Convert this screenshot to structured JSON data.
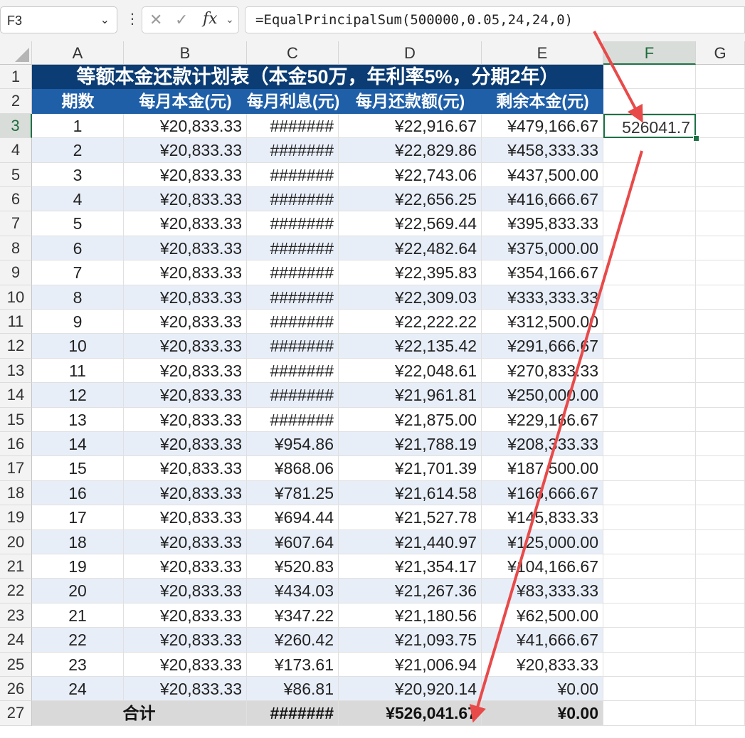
{
  "namebox": {
    "value": "F3"
  },
  "formula_bar": {
    "formula": "=EqualPrincipalSum(500000,0.05,24,24,0)",
    "fx_label": "fx"
  },
  "columns": [
    "A",
    "B",
    "C",
    "D",
    "E",
    "F",
    "G"
  ],
  "selected_cell": {
    "ref": "F3",
    "value": "526041.7"
  },
  "sheet": {
    "title": "等额本金还款计划表（本金50万，年利率5%，分期2年）",
    "headers": [
      "期数",
      "每月本金(元)",
      "每月利息(元)",
      "每月还款额(元)",
      "剩余本金(元)"
    ],
    "rows": [
      [
        "1",
        "¥20,833.33",
        "#######",
        "¥22,916.67",
        "¥479,166.67"
      ],
      [
        "2",
        "¥20,833.33",
        "#######",
        "¥22,829.86",
        "¥458,333.33"
      ],
      [
        "3",
        "¥20,833.33",
        "#######",
        "¥22,743.06",
        "¥437,500.00"
      ],
      [
        "4",
        "¥20,833.33",
        "#######",
        "¥22,656.25",
        "¥416,666.67"
      ],
      [
        "5",
        "¥20,833.33",
        "#######",
        "¥22,569.44",
        "¥395,833.33"
      ],
      [
        "6",
        "¥20,833.33",
        "#######",
        "¥22,482.64",
        "¥375,000.00"
      ],
      [
        "7",
        "¥20,833.33",
        "#######",
        "¥22,395.83",
        "¥354,166.67"
      ],
      [
        "8",
        "¥20,833.33",
        "#######",
        "¥22,309.03",
        "¥333,333.33"
      ],
      [
        "9",
        "¥20,833.33",
        "#######",
        "¥22,222.22",
        "¥312,500.00"
      ],
      [
        "10",
        "¥20,833.33",
        "#######",
        "¥22,135.42",
        "¥291,666.67"
      ],
      [
        "11",
        "¥20,833.33",
        "#######",
        "¥22,048.61",
        "¥270,833.33"
      ],
      [
        "12",
        "¥20,833.33",
        "#######",
        "¥21,961.81",
        "¥250,000.00"
      ],
      [
        "13",
        "¥20,833.33",
        "#######",
        "¥21,875.00",
        "¥229,166.67"
      ],
      [
        "14",
        "¥20,833.33",
        "¥954.86",
        "¥21,788.19",
        "¥208,333.33"
      ],
      [
        "15",
        "¥20,833.33",
        "¥868.06",
        "¥21,701.39",
        "¥187,500.00"
      ],
      [
        "16",
        "¥20,833.33",
        "¥781.25",
        "¥21,614.58",
        "¥166,666.67"
      ],
      [
        "17",
        "¥20,833.33",
        "¥694.44",
        "¥21,527.78",
        "¥145,833.33"
      ],
      [
        "18",
        "¥20,833.33",
        "¥607.64",
        "¥21,440.97",
        "¥125,000.00"
      ],
      [
        "19",
        "¥20,833.33",
        "¥520.83",
        "¥21,354.17",
        "¥104,166.67"
      ],
      [
        "20",
        "¥20,833.33",
        "¥434.03",
        "¥21,267.36",
        "¥83,333.33"
      ],
      [
        "21",
        "¥20,833.33",
        "¥347.22",
        "¥21,180.56",
        "¥62,500.00"
      ],
      [
        "22",
        "¥20,833.33",
        "¥260.42",
        "¥21,093.75",
        "¥41,666.67"
      ],
      [
        "23",
        "¥20,833.33",
        "¥173.61",
        "¥21,006.94",
        "¥20,833.33"
      ],
      [
        "24",
        "¥20,833.33",
        "¥86.81",
        "¥20,920.14",
        "¥0.00"
      ]
    ],
    "total": {
      "label": "合计",
      "interest": "#######",
      "payment": "¥526,041.67",
      "remaining": "¥0.00"
    }
  },
  "colors": {
    "title_bg": "#0b3c73",
    "header_bg": "#1f5fa8",
    "band_bg": "#e8eef8",
    "arrow": "#e84a4a",
    "selection": "#1e7145"
  }
}
